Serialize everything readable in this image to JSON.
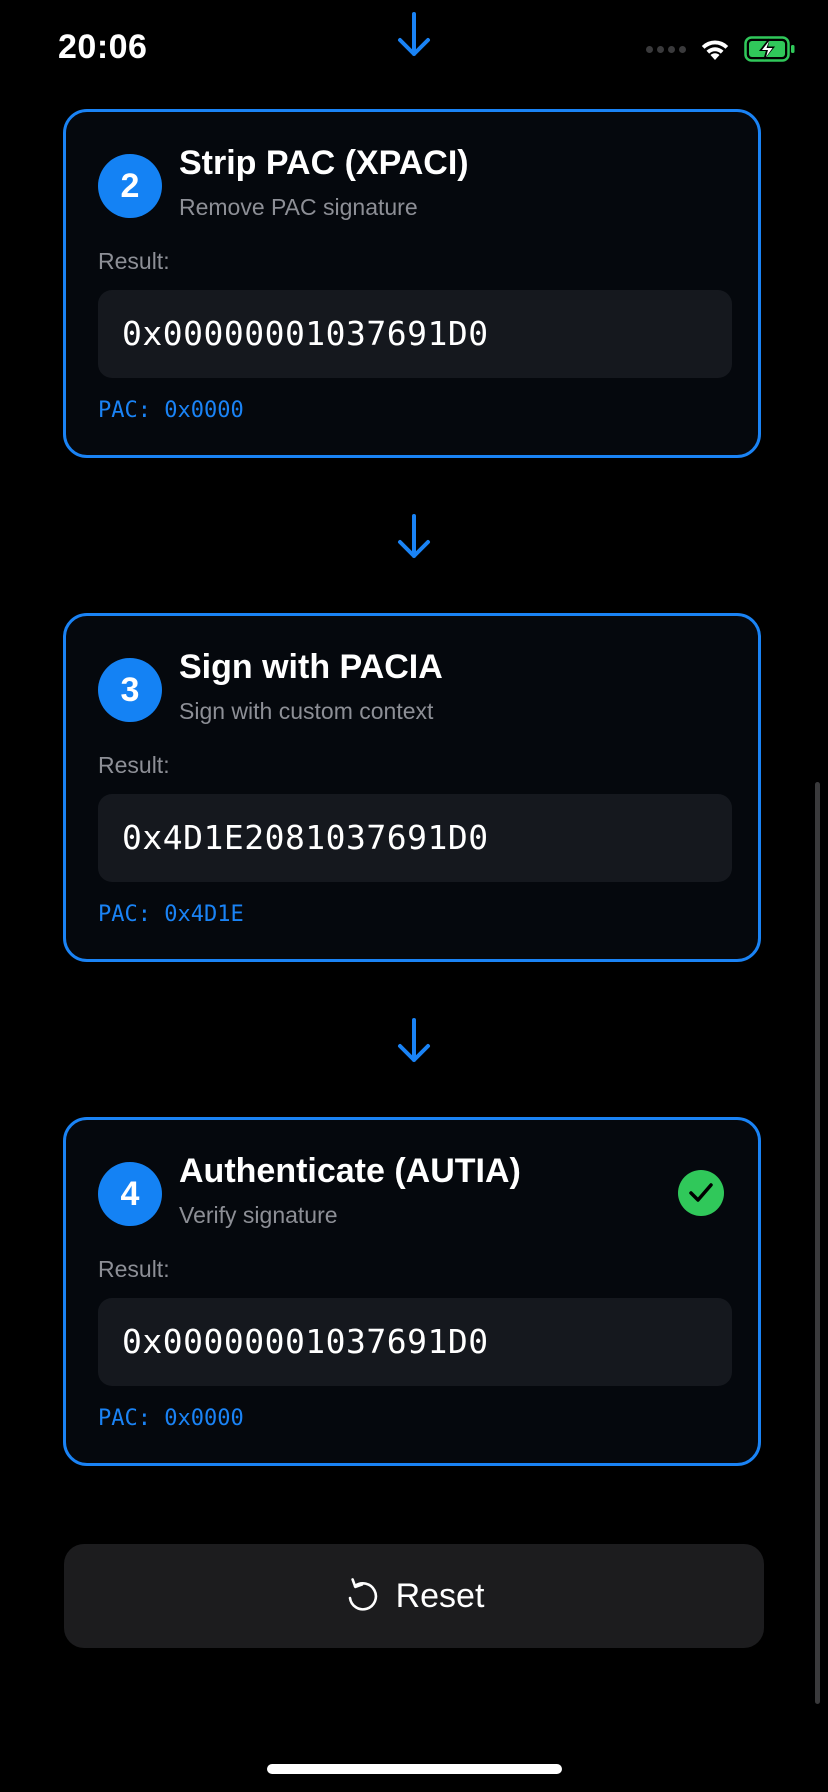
{
  "status_bar": {
    "time": "20:06"
  },
  "steps": [
    {
      "number": "2",
      "title": "Strip PAC (XPACI)",
      "subtitle": "Remove PAC signature",
      "result_label": "Result:",
      "result_value": "0x00000001037691D0",
      "pac": "PAC: 0x0000"
    },
    {
      "number": "3",
      "title": "Sign with PACIA",
      "subtitle": "Sign with custom context",
      "result_label": "Result:",
      "result_value": "0x4D1E2081037691D0",
      "pac": "PAC: 0x4D1E"
    },
    {
      "number": "4",
      "title": "Authenticate (AUTIA)",
      "subtitle": "Verify signature",
      "result_label": "Result:",
      "result_value": "0x00000001037691D0",
      "pac": "PAC: 0x0000",
      "verified": true
    }
  ],
  "reset_button": {
    "label": "Reset",
    "icon": "reset-icon"
  },
  "colors": {
    "accent": "#1a83f5",
    "success": "#30c85a",
    "background": "#000000",
    "card_background": "#05080d",
    "result_box": "#15181e",
    "secondary_text": "#8d8f96"
  }
}
